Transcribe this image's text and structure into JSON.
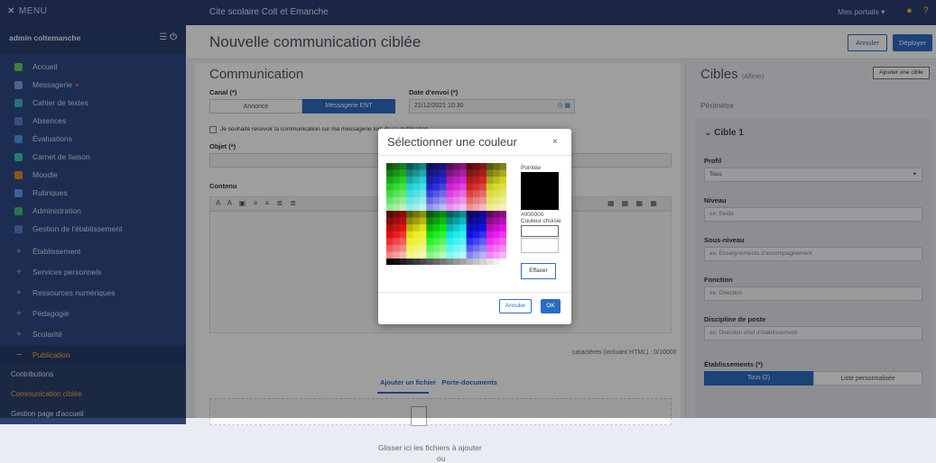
{
  "topbar": {
    "menu": "MENU",
    "site": "Cite scolaire Colt et Emanche",
    "portals": "Mes portails ▾"
  },
  "sidebar": {
    "user": "admin coltemanche",
    "items": [
      {
        "label": "Accueil",
        "color": "#5fd35a"
      },
      {
        "label": "Messagerie",
        "color": "#7fa0e6",
        "dot": "●"
      },
      {
        "label": "Cahier de textes",
        "color": "#3bb9c9"
      },
      {
        "label": "Absences",
        "color": "#5d7fd0"
      },
      {
        "label": "Évaluations",
        "color": "#4aa0e8"
      },
      {
        "label": "Carnet de liaison",
        "color": "#3bc9b4"
      },
      {
        "label": "Moodle",
        "color": "#e08a2d"
      },
      {
        "label": "Rubriques",
        "color": "#5fa0f0"
      },
      {
        "label": "Administration",
        "color": "#41c17b"
      },
      {
        "label": "Gestion de l'établissement",
        "color": "#5d7fd0"
      }
    ],
    "groups": [
      "Établissement",
      "Services personnels",
      "Ressources numériques",
      "Pédagogie",
      "Scolarité"
    ],
    "publication": "Publication",
    "subitems": [
      "Contributions",
      "Communication ciblée",
      "Gestion page d'accueil"
    ]
  },
  "page": {
    "title": "Nouvelle communication ciblée",
    "cancel": "Annuler",
    "deploy": "Déployer"
  },
  "communication": {
    "heading": "Communication",
    "canal_label": "Canal (*)",
    "canal_options": [
      "Annonce",
      "Messagerie ENT"
    ],
    "date_label": "Date d'envoi (*)",
    "date_value": "21/12/2021 10:30",
    "checkbox_label": "Je souhaite recevoir la communication sur ma messagerie lors de sa publication",
    "objet_label": "Objet (*)",
    "contenu_label": "Contenu",
    "toolbar_left": "A A ▣ ≡ ≡ ≣ ≣",
    "toolbar_right": "▦ ▦ ▦ ▦",
    "counter": "caractères (incluant HTML) : 0/10000",
    "tab_fichier": "Ajouter un fichier",
    "tab_porte": "Porte-documents",
    "drop_text": "Glisser ici les fichiers à ajouter",
    "drop_text2": "ou"
  },
  "cibles": {
    "heading": "Cibles",
    "heading_small": "(Affiner)",
    "add_button": "Ajouter une cible",
    "perimetre": "Périmètre",
    "card_title": "Cible 1",
    "profil_label": "Profil",
    "profil_value": "Tous",
    "niveau_label": "Niveau",
    "niveau_placeholder": "ex: Seide",
    "sousniveau_label": "Sous-niveau",
    "sousniveau_placeholder": "ex: Enseignements d'accompagnement",
    "fonction_label": "Fonction",
    "fonction_placeholder": "ex: Direction",
    "discipline_label": "Discipline de poste",
    "discipline_placeholder": "ex: Direction chef d'établissement",
    "etab_label": "Établissements (*)",
    "etab_tous": "Tous (2)",
    "etab_liste": "Liste personnalisée"
  },
  "modal": {
    "title": "Sélectionner une couleur",
    "close": "×",
    "pointee_label": "Pointée",
    "hex": "#000000",
    "choisie_label": "Couleur choisie",
    "clear": "Effacer",
    "cancel": "Annuler",
    "ok": "OK"
  }
}
